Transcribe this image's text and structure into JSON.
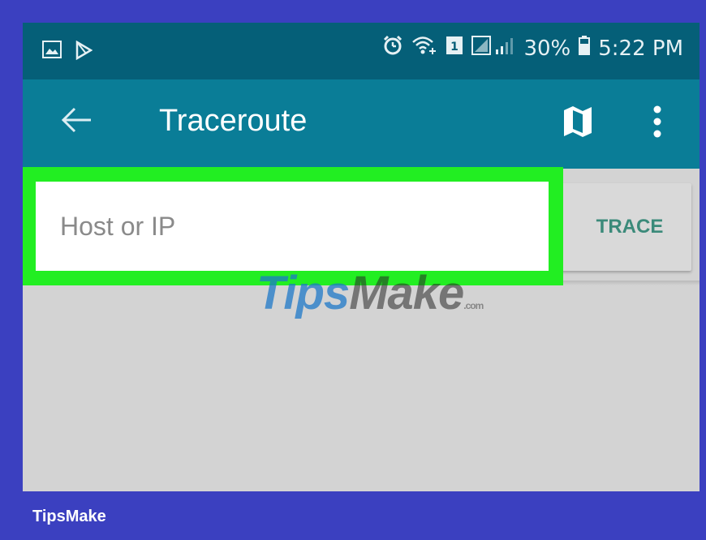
{
  "status_bar": {
    "battery": "30%",
    "time": "5:22 PM",
    "left_icons": [
      "image-icon",
      "play-store-icon"
    ],
    "right_icons": [
      "alarm-icon",
      "wifi-icon",
      "sim-icon",
      "signal-icon",
      "battery-icon"
    ]
  },
  "app_bar": {
    "title": "Traceroute",
    "back_icon": "arrow-left-icon",
    "map_icon": "map-icon",
    "more_icon": "more-vertical-icon"
  },
  "search": {
    "placeholder": "Host or IP",
    "value": "",
    "button_label": "TRACE"
  },
  "watermark": {
    "part1": "Tips",
    "part2": "Make",
    "suffix": ".com"
  },
  "caption": "TipsMake",
  "colors": {
    "frame": "#3b40c0",
    "status_bar": "#055f78",
    "app_bar": "#0a7d97",
    "highlight": "#22ee22",
    "content_bg": "#d3d3d3",
    "trace_text": "#3b8a7a"
  }
}
